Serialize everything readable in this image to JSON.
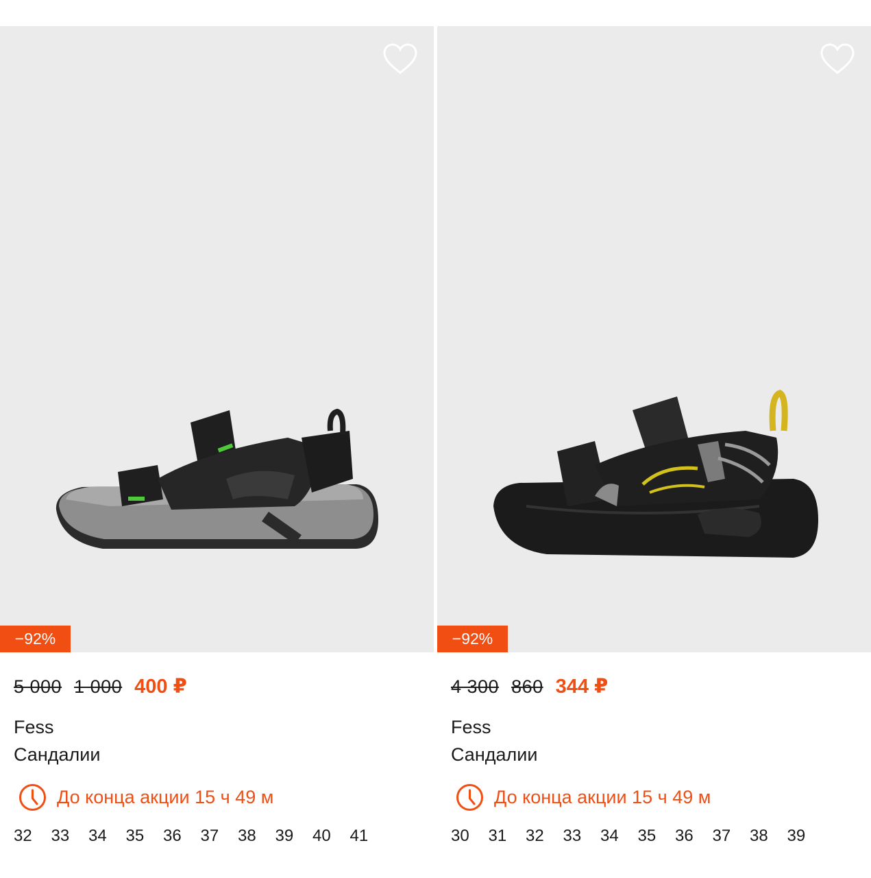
{
  "colors": {
    "accent": "#f04e13",
    "photo_bg": "#ebebeb"
  },
  "products": [
    {
      "discount": "−92%",
      "price_original": "5 000",
      "price_previous": "1 000",
      "price_current": "400 ₽",
      "brand": "Fess",
      "category": "Сандалии",
      "promo_text": "До конца акции 15 ч 49 м",
      "favorite_icon": "heart-outline-icon",
      "timer_icon": "clock-icon",
      "sizes": [
        "32",
        "33",
        "34",
        "35",
        "36",
        "37",
        "38",
        "39",
        "40",
        "41"
      ]
    },
    {
      "discount": "−92%",
      "price_original": "4 300",
      "price_previous": "860",
      "price_current": "344 ₽",
      "brand": "Fess",
      "category": "Сандалии",
      "promo_text": "До конца акции 15 ч 49 м",
      "favorite_icon": "heart-outline-icon",
      "timer_icon": "clock-icon",
      "sizes": [
        "30",
        "31",
        "32",
        "33",
        "34",
        "35",
        "36",
        "37",
        "38",
        "39"
      ]
    }
  ]
}
